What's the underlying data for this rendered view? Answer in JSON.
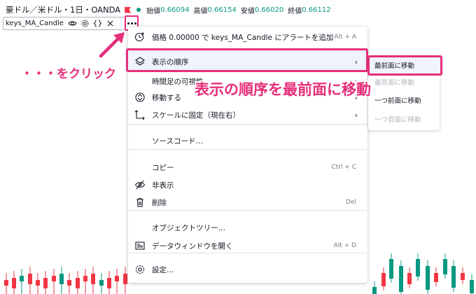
{
  "header": {
    "symbol": "豪ドル／米ドル・1日・OANDA",
    "open_label": "始値",
    "open_value": "0.66094",
    "high_label": "高値",
    "high_value": "0.66154",
    "low_label": "安値",
    "low_value": "0.66020",
    "close_label": "終値",
    "close_value": "0.66112"
  },
  "indicator": {
    "name": "keys_MA_Candle",
    "icons": [
      "eye-icon",
      "gear-icon",
      "braces-icon",
      "close-icon"
    ],
    "more_icon": "more-dots-icon"
  },
  "menu": {
    "items": [
      {
        "icon": "alert-clock-icon",
        "label": "価格 0.00000 で keys_MA_Candle にアラートを追加",
        "shortcut": "Alt + A"
      },
      {
        "icon": "layers-icon",
        "label": "表示の順序",
        "submenu": true
      },
      {
        "icon": "",
        "label": "時間足の可視性",
        "submenu": true
      },
      {
        "icon": "move-icon",
        "label": "移動する",
        "submenu": true
      },
      {
        "icon": "scale-pin-icon",
        "label": "スケールに固定（現在右）",
        "submenu": true
      },
      {
        "icon": "",
        "label": "ソースコード…"
      },
      {
        "icon": "",
        "label": "コピー",
        "shortcut": "Ctrl + C"
      },
      {
        "icon": "eye-off-icon",
        "label": "非表示"
      },
      {
        "icon": "trash-icon",
        "label": "削除",
        "shortcut": "Del"
      },
      {
        "icon": "",
        "label": "オブジェクトツリー…"
      },
      {
        "icon": "data-window-icon",
        "label": "データウィンドウを開く",
        "shortcut": "Alt + D"
      },
      {
        "icon": "gear-icon",
        "label": "設定…"
      }
    ]
  },
  "submenu": {
    "items": [
      {
        "label": "最前面に移動",
        "enabled": true
      },
      {
        "label": "最背面に移動",
        "enabled": false
      },
      {
        "label": "一つ前面に移動",
        "enabled": true
      },
      {
        "label": "一つ背面に移動",
        "enabled": false
      }
    ]
  },
  "annotations": {
    "click_hint": "・・・をクリック",
    "order_hint": "表示の順序を最前面に移動"
  },
  "colors": {
    "accent": "#e62e79",
    "up": "#089981",
    "down": "#f23645",
    "text": "#131722",
    "muted": "#787b86"
  }
}
